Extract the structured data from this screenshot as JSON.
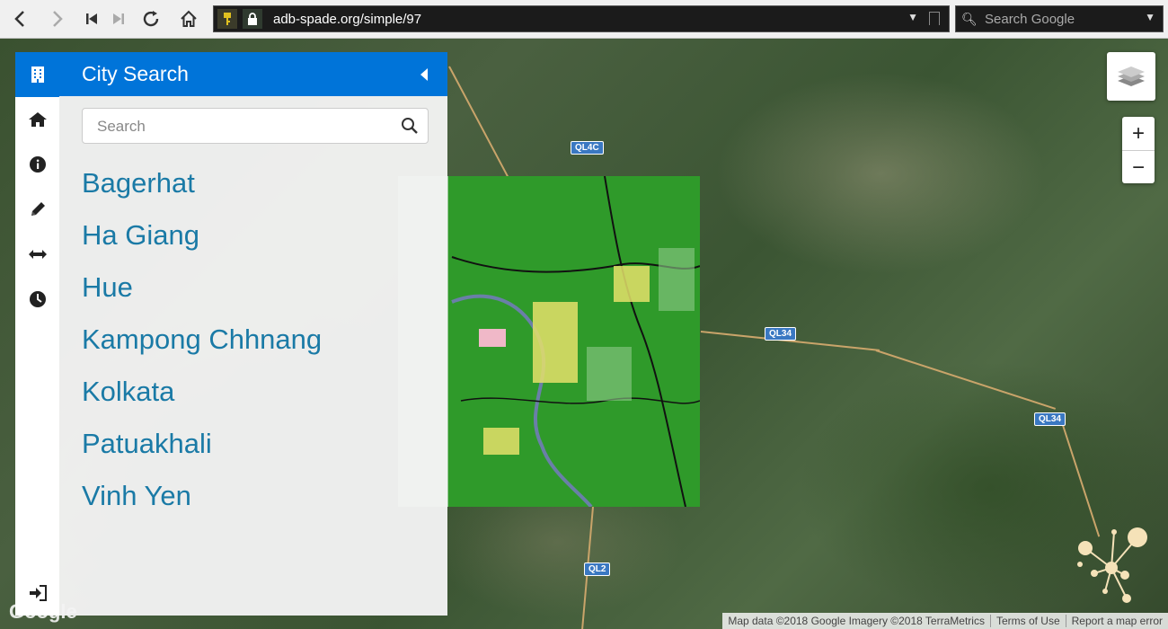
{
  "browser": {
    "url": "adb-spade.org/simple/97",
    "search_placeholder": "Search Google"
  },
  "sidebar": {
    "title": "City Search",
    "search_placeholder": "Search",
    "cities": [
      "Bagerhat",
      "Ha Giang",
      "Hue",
      "Kampong Chhnang",
      "Kolkata",
      "Patuakhali",
      "Vinh Yen"
    ],
    "tabs": [
      "building-icon",
      "home-icon",
      "info-icon",
      "pencil-icon",
      "arrows-h-icon",
      "clock-icon"
    ],
    "footer_icon": "sign-in-icon",
    "accent": "#0074d9",
    "link_color": "#1a7aa6"
  },
  "map": {
    "road_labels": [
      "QL4C",
      "QL34",
      "QL34",
      "QL2"
    ],
    "attribution": {
      "data": "Map data ©2018 Google Imagery ©2018 TerraMetrics",
      "terms": "Terms of Use",
      "report": "Report a map error"
    },
    "logo": "Google",
    "zoom_in": "+",
    "zoom_out": "−",
    "overlay_color": "#2f9a2a"
  }
}
